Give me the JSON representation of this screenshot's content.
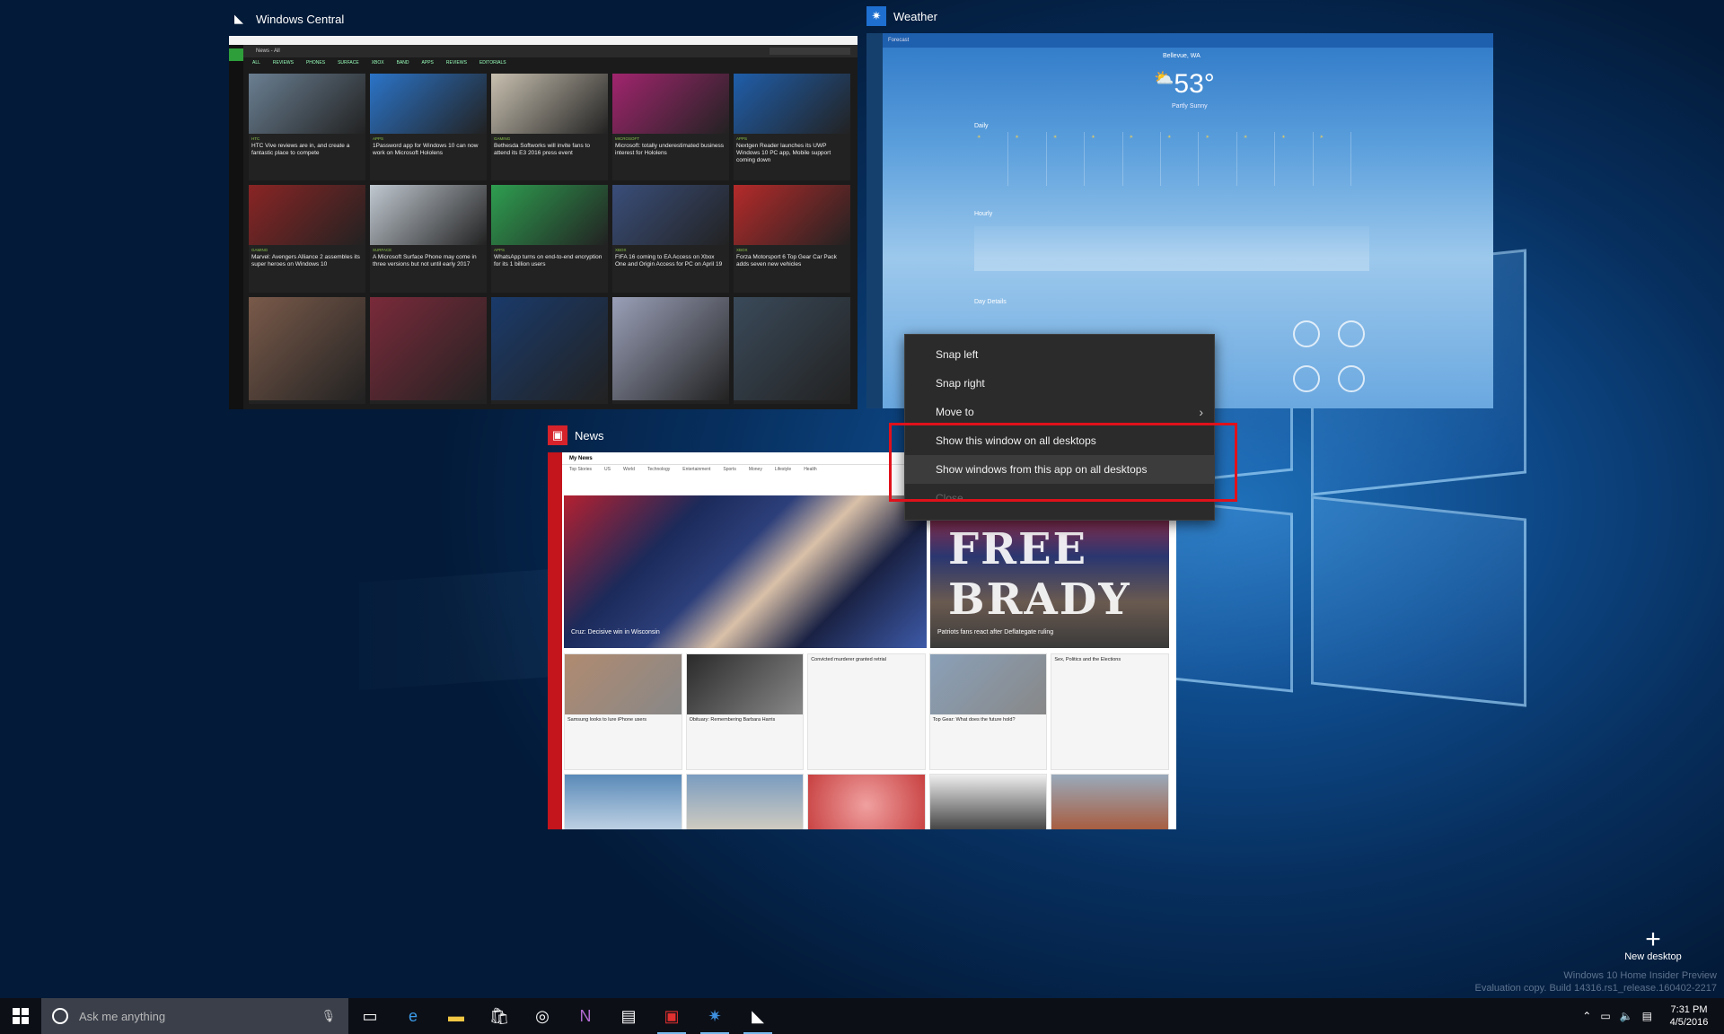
{
  "windows": {
    "wc": {
      "title": "Windows Central",
      "nav_label": "News - All",
      "tabs": [
        "ALL",
        "REVIEWS",
        "PHONES",
        "SURFACE",
        "XBOX",
        "BAND",
        "APPS",
        "REVIEWS",
        "EDITORIALS"
      ],
      "cards": [
        {
          "cat": "HTC",
          "text": "HTC Vive reviews are in, and create a fantastic place to compete"
        },
        {
          "cat": "APPS",
          "text": "1Password app for Windows 10 can now work on Microsoft Hololens"
        },
        {
          "cat": "GAMING",
          "text": "Bethesda Softworks will invite fans to attend its E3 2016 press event"
        },
        {
          "cat": "MICROSOFT",
          "text": "Microsoft: totally underestimated business interest for Hololens"
        },
        {
          "cat": "APPS",
          "text": "Nextgen Reader launches its UWP Windows 10 PC app, Mobile support coming down"
        },
        {
          "cat": "GAMING",
          "text": "Marvel: Avengers Alliance 2 assembles its super heroes on Windows 10"
        },
        {
          "cat": "SURFACE",
          "text": "A Microsoft Surface Phone may come in three versions but not until early 2017"
        },
        {
          "cat": "APPS",
          "text": "WhatsApp turns on end-to-end encryption for its 1 billion users"
        },
        {
          "cat": "XBOX",
          "text": "FIFA 16 coming to EA Access on Xbox One and Origin Access for PC on April 19"
        },
        {
          "cat": "XBOX",
          "text": "Forza Motorsport 6 Top Gear Car Pack adds seven new vehicles"
        },
        {
          "cat": "",
          "text": ""
        },
        {
          "cat": "",
          "text": ""
        },
        {
          "cat": "",
          "text": ""
        },
        {
          "cat": "",
          "text": ""
        },
        {
          "cat": "",
          "text": ""
        }
      ]
    },
    "weather": {
      "title": "Weather",
      "header": "Forecast",
      "location": "Bellevue, WA",
      "temp": "53°",
      "condition": "Partly Sunny",
      "daily_label": "Daily",
      "hourly_label": "Hourly",
      "day_details": "Day Details"
    },
    "news": {
      "title": "News",
      "header": "My News",
      "tabs": [
        "Top Stories",
        "US",
        "World",
        "Technology",
        "Entertainment",
        "Sports",
        "Money",
        "Lifestyle",
        "Health"
      ],
      "hero1_caption": "Cruz: Decisive win in Wisconsin",
      "hero2_caption": "Patriots fans react after Deflategate ruling",
      "hero2_sign": "FREE BRADY",
      "cards": [
        {
          "text": "Samsung looks to lure iPhone users"
        },
        {
          "text": "Obituary: Remembering Barbara Harris"
        },
        {
          "text": "Convicted murderer granted retrial"
        },
        {
          "text": "Top Gear: What does the future hold?"
        },
        {
          "text": "Sex, Politics and the Elections"
        }
      ]
    }
  },
  "context_menu": {
    "items": [
      {
        "label": "Snap left"
      },
      {
        "label": "Snap right"
      },
      {
        "label": "Move to",
        "chevron": "›"
      },
      {
        "label": "Show this window on all desktops"
      },
      {
        "label": "Show windows from this app on all desktops"
      },
      {
        "label": "Close"
      }
    ]
  },
  "new_desktop": {
    "icon": "+",
    "label": "New desktop"
  },
  "watermark": {
    "line1": "Windows 10 Home Insider Preview",
    "line2": "Evaluation copy. Build 14316.rs1_release.160402-2217"
  },
  "taskbar": {
    "search_placeholder": "Ask me anything",
    "apps": [
      {
        "name": "task-view-icon",
        "glyph": "▭"
      },
      {
        "name": "edge-icon",
        "glyph": "e",
        "color": "#3c9be8"
      },
      {
        "name": "file-explorer-icon",
        "glyph": "▬",
        "color": "#f2c744"
      },
      {
        "name": "store-icon",
        "glyph": "🛍",
        "color": "#ffffff"
      },
      {
        "name": "groove-icon",
        "glyph": "◎",
        "color": "#ffffff"
      },
      {
        "name": "onenote-icon",
        "glyph": "N",
        "color": "#b26ad2"
      },
      {
        "name": "sway-icon",
        "glyph": "▤",
        "color": "#ffffff"
      },
      {
        "name": "news-icon",
        "glyph": "▣",
        "color": "#e03030"
      },
      {
        "name": "weather-icon",
        "glyph": "✷",
        "color": "#3e8fe0"
      },
      {
        "name": "windows-central-icon",
        "glyph": "◣",
        "color": "#ffffff"
      }
    ],
    "time": "7:31 PM",
    "date": "4/5/2016"
  }
}
